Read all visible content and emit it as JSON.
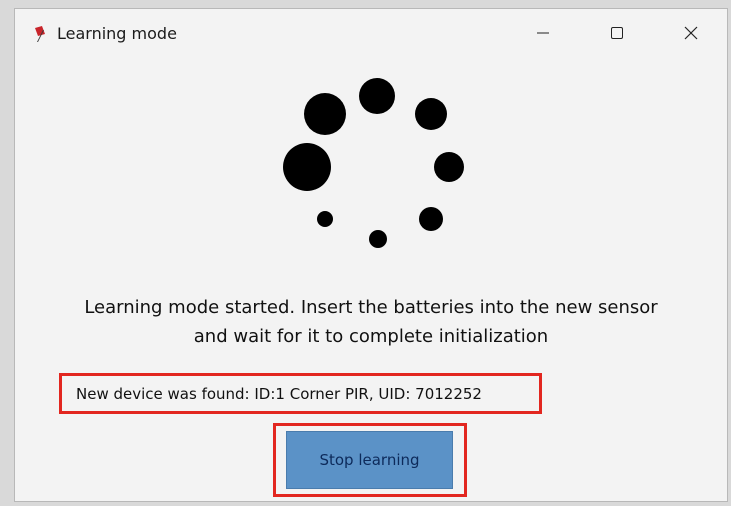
{
  "window": {
    "title": "Learning mode",
    "controls": {
      "minimize": "minimize-icon",
      "maximize": "maximize-icon",
      "close": "close-icon"
    }
  },
  "spinner": {
    "icon": "loading-spinner-icon"
  },
  "message": {
    "line1": "Learning mode started. Insert the batteries into the new sensor",
    "line2": "and wait for it to complete initialization"
  },
  "device_status": "New device was found: ID:1 Corner PIR, UID: 7012252",
  "stop_button": {
    "label": "Stop learning"
  },
  "colors": {
    "highlight": "#e2261f",
    "button": "#5b92c7",
    "button_text": "#0d2a5a"
  }
}
